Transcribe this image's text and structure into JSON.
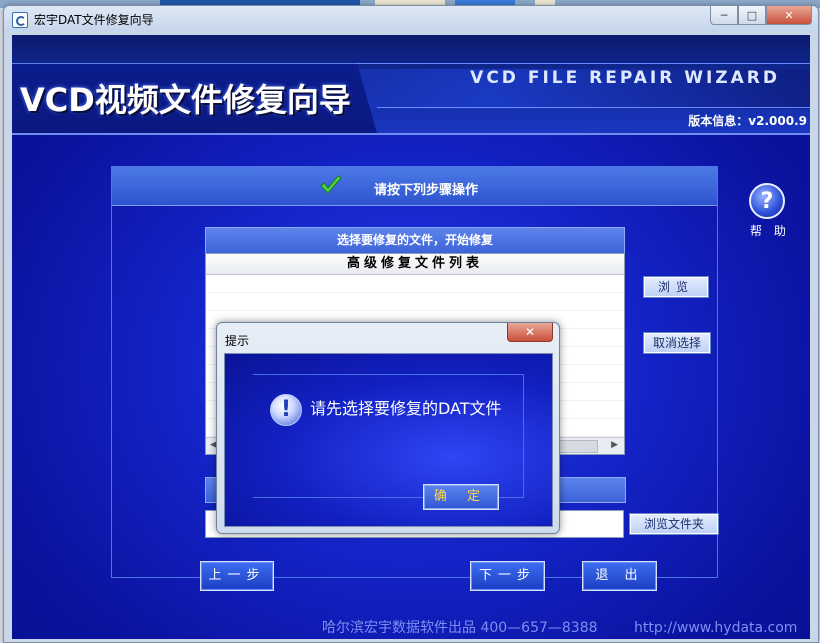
{
  "window": {
    "title": "宏宇DAT文件修复向导"
  },
  "header": {
    "title": "VCD视频文件修复向导",
    "subtitle": "VCD FILE REPAIR WIZARD",
    "version": "版本信息：v2.000.9"
  },
  "help": {
    "label": "帮 助"
  },
  "panel": {
    "title": "请按下列步骤操作"
  },
  "filebox": {
    "heading": "选择要修复的文件，开始修复",
    "list_column": "高级修复文件列表",
    "rows": []
  },
  "buttons": {
    "browse": "浏览",
    "deselect": "取消选择",
    "browse_folder": "浏览文件夹",
    "prev": "上一步",
    "next": "下一步",
    "exit": "退 出"
  },
  "footer": {
    "company": "哈尔滨宏宇数据软件出品  400—657—8388",
    "url": "http://www.hydata.com"
  },
  "dialog": {
    "title": "提示",
    "message": "请先选择要修复的DAT文件",
    "ok": "确 定"
  },
  "colors": {
    "background": "#1424c8",
    "accent": "#3d63d8",
    "ok_text": "#ffd84a"
  }
}
